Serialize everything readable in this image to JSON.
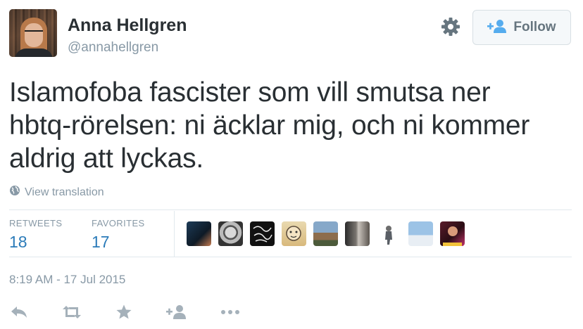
{
  "user": {
    "name": "Anna Hellgren",
    "handle": "@annahellgren"
  },
  "follow_button": {
    "label": "Follow",
    "icon": "add-user-icon"
  },
  "settings_icon": "gear-icon",
  "tweet": {
    "text_lines": [
      "Islamofoba fascister som vill smutsa ner",
      "hbtq-rörelsen: ni äcklar mig, och ni kommer",
      "aldrig att lyckas."
    ],
    "view_translation": "View translation"
  },
  "stats": {
    "retweets_label": "RETWEETS",
    "retweets_count": "18",
    "favorites_label": "FAVORITES",
    "favorites_count": "17"
  },
  "timestamp": "8:19 AM - 17 Jul 2015",
  "actions": [
    "reply-icon",
    "retweet-icon",
    "favorite-icon",
    "follow-icon",
    "more-icon"
  ],
  "colors": {
    "text": "#292f33",
    "muted": "#8899a6",
    "link_blue": "#2b7bb9",
    "follow_icon_blue": "#55acee",
    "border": "#e1e8ed"
  }
}
